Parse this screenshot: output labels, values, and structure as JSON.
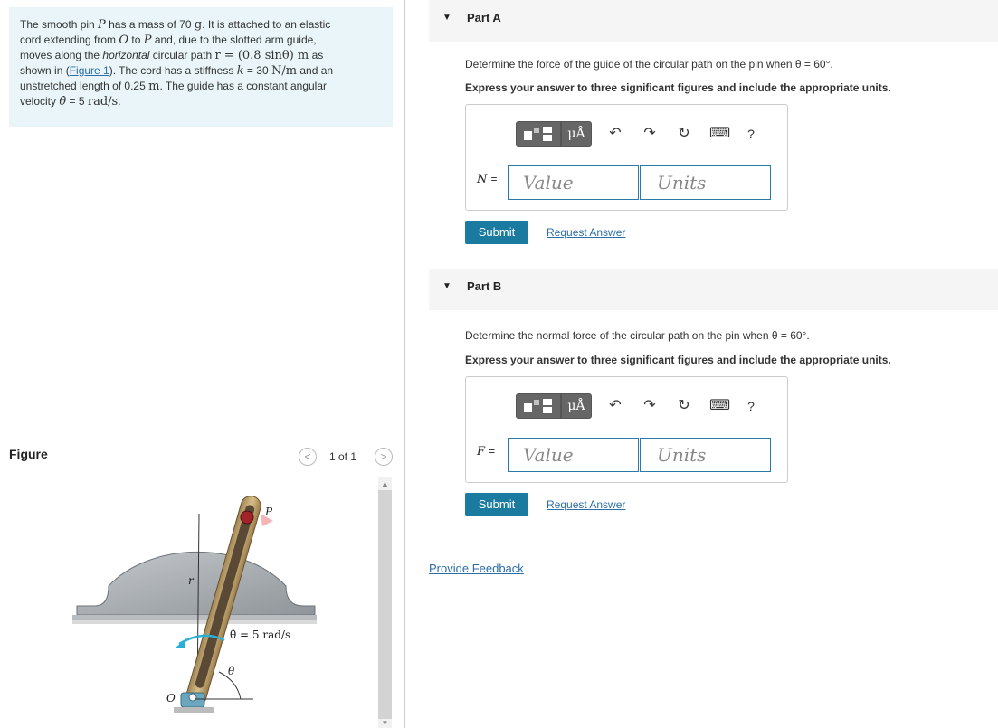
{
  "problem": {
    "t1": "The smooth pin ",
    "P": "P",
    "t2": " has a mass of 70 ",
    "g": "g",
    "t3": ". It is attached to an elastic",
    "t4": "cord extending from ",
    "O": "O",
    "t5": " to ",
    "P2": "P",
    "t6": " and, due to the slotted arm guide,",
    "t7": "moves along the ",
    "horizontal": "horizontal",
    "t8": " circular path ",
    "r_eq": "r = (0.8 sinθ) m",
    "t9": " as",
    "t10": "shown in (",
    "fig_link": "Figure 1",
    "t11": "). The cord has a stiffness ",
    "k_eq": "k",
    "t12": " = 30 ",
    "k_unit": "N/m",
    "t13": " and an",
    "t14": "unstretched length of 0.25 ",
    "m": "m",
    "t15": ". The guide has a constant angular",
    "t16": "velocity ",
    "thetadot": "θ̇",
    "t17": " = 5 ",
    "rads": "rad/s",
    "t18": "."
  },
  "figure": {
    "title": "Figure",
    "count": "1 of 1",
    "prev": "<",
    "next": ">",
    "label_P": "P",
    "label_r": "r",
    "label_O": "O",
    "label_theta": "θ",
    "label_omega": "θ̇ = 5 rad/s"
  },
  "partA": {
    "label": "Part A",
    "question": "Determine the force of the guide of the circular path on the pin when θ = 60°.",
    "instruction": "Express your answer to three significant figures and include the appropriate units.",
    "var": "N",
    "eq": "=",
    "value_placeholder": "Value",
    "units_placeholder": "Units",
    "submit": "Submit",
    "request": "Request Answer"
  },
  "partB": {
    "label": "Part B",
    "question": "Determine the normal force of the circular path on the pin when θ = 60°.",
    "instruction": "Express your answer to three significant figures and include the appropriate units.",
    "var": "F",
    "eq": "=",
    "value_placeholder": "Value",
    "units_placeholder": "Units",
    "submit": "Submit",
    "request": "Request Answer"
  },
  "toolbar": {
    "mu": "μÅ",
    "undo_icon": "undo-icon",
    "redo_icon": "redo-icon",
    "reset_icon": "reset-icon",
    "keyboard_icon": "keyboard-icon",
    "help": "?"
  },
  "feedback": "Provide Feedback"
}
